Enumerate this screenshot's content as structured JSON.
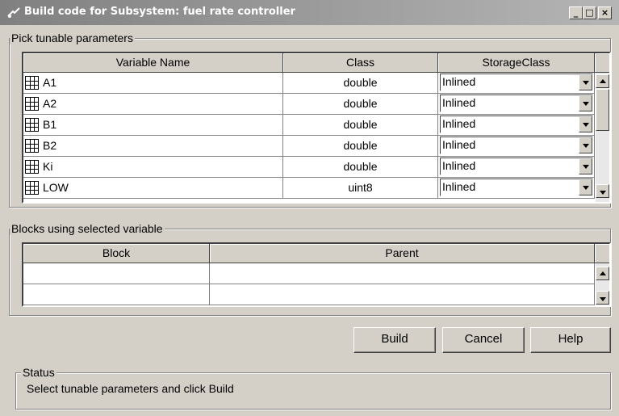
{
  "window": {
    "title": "Build code for Subsystem: fuel rate controller",
    "controls": {
      "minimize": "_",
      "maximize": "□",
      "close": "×"
    }
  },
  "params": {
    "group_label": "Pick tunable parameters",
    "columns": [
      "Variable Name",
      "Class",
      "StorageClass"
    ],
    "rows": [
      {
        "name": "A1",
        "class": "double",
        "storage": "Inlined"
      },
      {
        "name": "A2",
        "class": "double",
        "storage": "Inlined"
      },
      {
        "name": "B1",
        "class": "double",
        "storage": "Inlined"
      },
      {
        "name": "B2",
        "class": "double",
        "storage": "Inlined"
      },
      {
        "name": "Ki",
        "class": "double",
        "storage": "Inlined"
      },
      {
        "name": "LOW",
        "class": "uint8",
        "storage": "Inlined"
      }
    ]
  },
  "blocks": {
    "group_label": "Blocks using selected variable",
    "columns": [
      "Block",
      "Parent"
    ]
  },
  "buttons": {
    "build": "Build",
    "cancel": "Cancel",
    "help": "Help"
  },
  "status": {
    "group_label": "Status",
    "text": "Select tunable parameters and click Build"
  }
}
